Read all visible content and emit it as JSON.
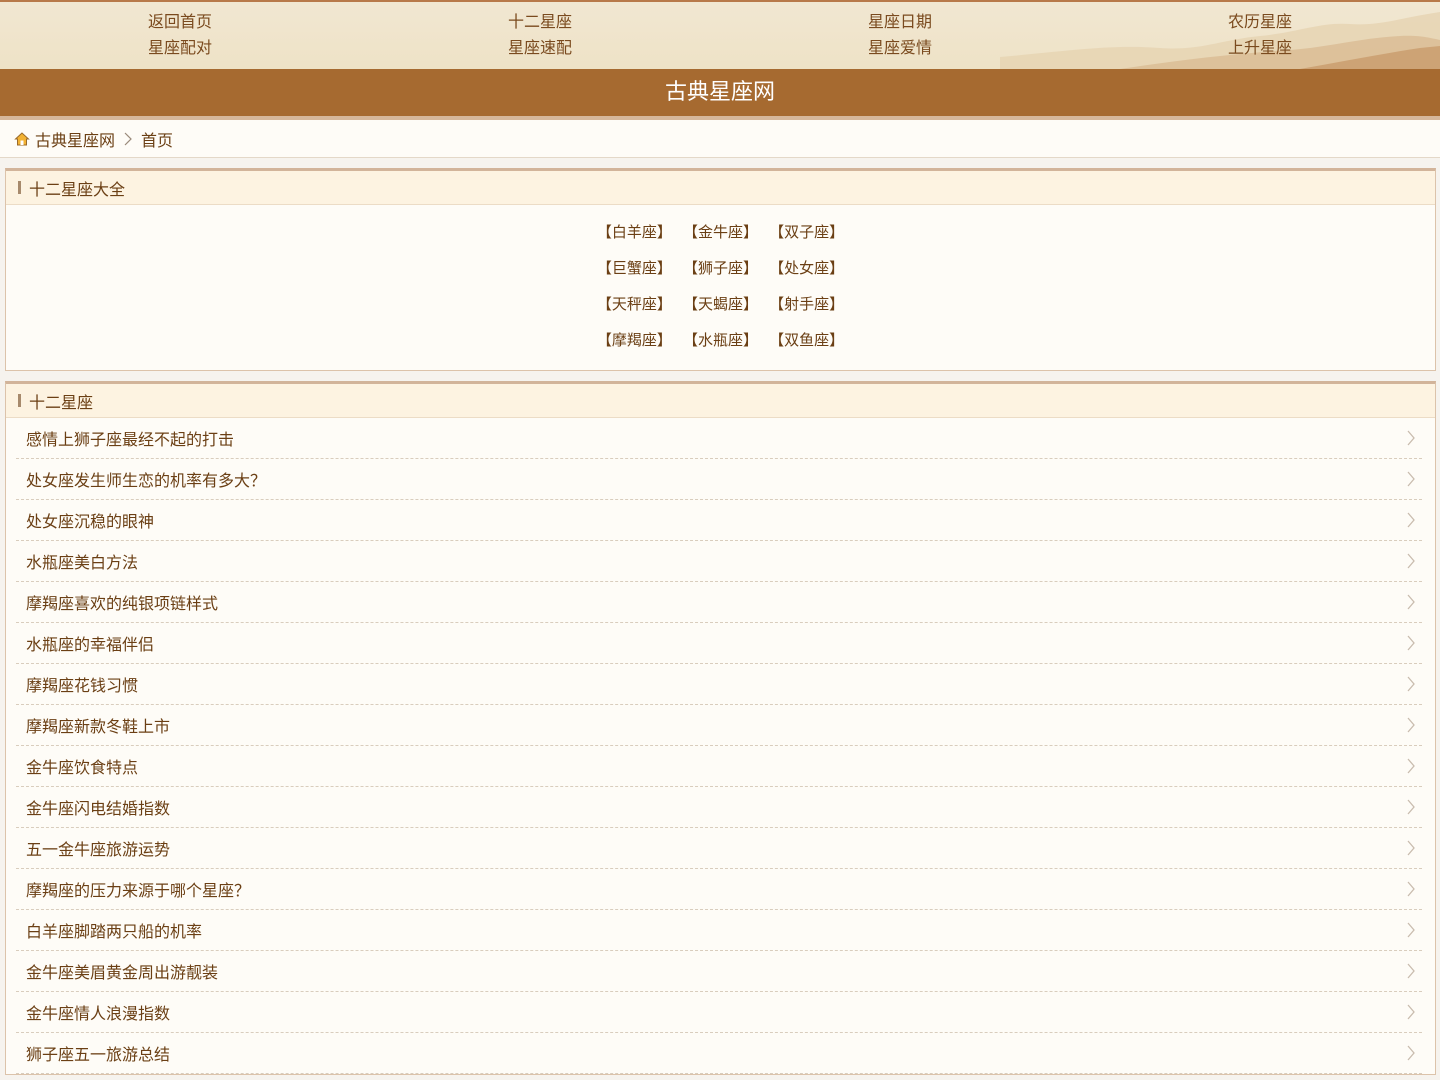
{
  "top_nav": [
    {
      "label": "返回首页"
    },
    {
      "label": "十二星座"
    },
    {
      "label": "星座日期"
    },
    {
      "label": "农历星座"
    },
    {
      "label": "星座配对"
    },
    {
      "label": "星座速配"
    },
    {
      "label": "星座爱情"
    },
    {
      "label": "上升星座"
    }
  ],
  "site_title": "古典星座网",
  "breadcrumb": {
    "home": "古典星座网",
    "current": "首页"
  },
  "zodiac_panel": {
    "title": "十二星座大全",
    "signs": [
      "【白羊座】",
      "【金牛座】",
      "【双子座】",
      "【巨蟹座】",
      "【狮子座】",
      "【处女座】",
      "【天秤座】",
      "【天蝎座】",
      "【射手座】",
      "【摩羯座】",
      "【水瓶座】",
      "【双鱼座】"
    ]
  },
  "articles_panel": {
    "title": "十二星座",
    "items": [
      "感情上狮子座最经不起的打击",
      "处女座发生师生恋的机率有多大？",
      "处女座沉稳的眼神",
      "水瓶座美白方法",
      "摩羯座喜欢的纯银项链样式",
      "水瓶座的幸福伴侣",
      "摩羯座花钱习惯",
      "摩羯座新款冬鞋上市",
      "金牛座饮食特点",
      "金牛座闪电结婚指数",
      "五一金牛座旅游运势",
      "摩羯座的压力来源于哪个星座？",
      "白羊座脚踏两只船的机率",
      "金牛座美眉黄金周出游靓装",
      "金牛座情人浪漫指数",
      "狮子座五一旅游总结"
    ]
  },
  "colors": {
    "accent": "#a66a30",
    "text": "#6b3f14",
    "panel_head": "#fdf3e1"
  }
}
